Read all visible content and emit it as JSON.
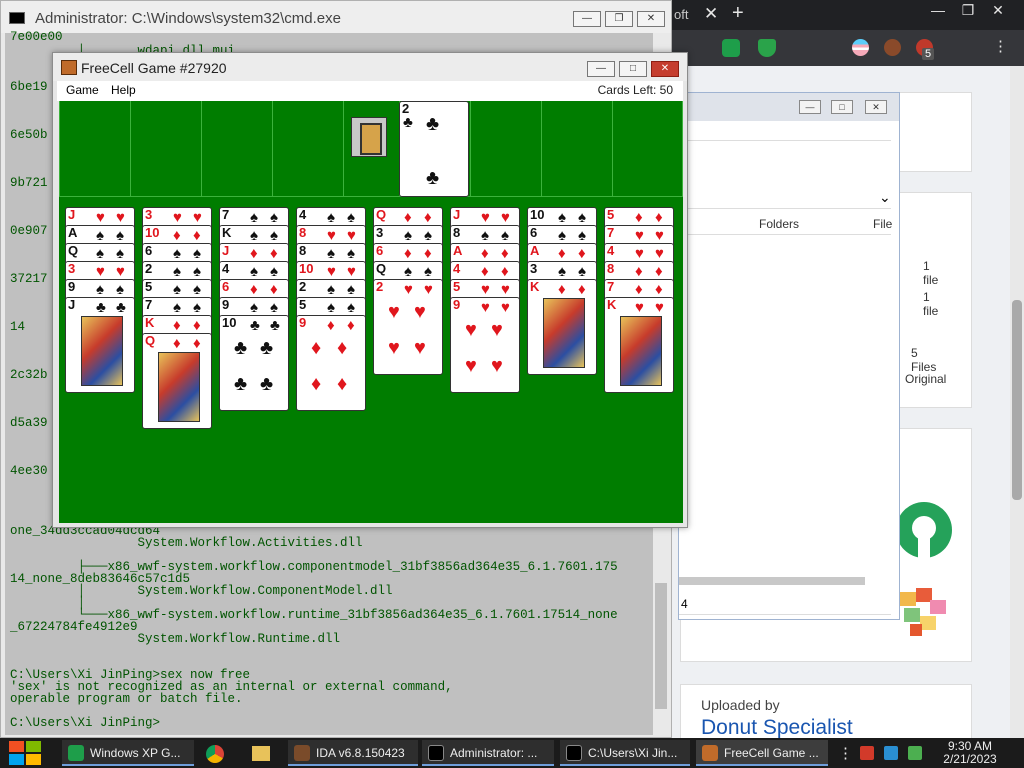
{
  "browser": {
    "tab_tail": "oft",
    "tab_close": "✕",
    "new_tab": "+",
    "window_buttons": [
      "—",
      "❐",
      "✕"
    ],
    "extension_badge": "5",
    "menu": "⋮"
  },
  "explorer": {
    "window_buttons": [
      "—",
      "□",
      "✕"
    ],
    "dropdown_arrow": "⌄",
    "columns": [
      "Folders",
      "File"
    ],
    "rows": [
      "1 file",
      "1 file",
      "5 Files",
      "Original"
    ],
    "path_fragment": "4"
  },
  "web": {
    "uploaded_by_label": "Uploaded by",
    "uploader_name": "Donut Specialist"
  },
  "cmd": {
    "title": "Administrator: C:\\Windows\\system32\\cmd.exe",
    "window_buttons": [
      "—",
      "❐",
      "✕"
    ],
    "lines": [
      "7e00e00",
      "         │       wdapi.dll.mui",
      "6be19",
      "6e50b",
      "9b721",
      "0e907",
      "37217",
      "14",
      "2c32b",
      "d5a39",
      "4ee30",
      "one_34dd3ccad04dcd64",
      "                 System.Workflow.Activities.dll",
      "         ├───x86_wwf-system.workflow.componentmodel_31bf3856ad364e35_6.1.7601.175",
      "14_none_8deb83646c57c1d5",
      "         │       System.Workflow.ComponentModel.dll",
      "         │",
      "         └───x86_wwf-system.workflow.runtime_31bf3856ad364e35_6.1.7601.17514_none",
      "_67224784fe4912e9",
      "                 System.Workflow.Runtime.dll",
      "",
      "C:\\Users\\Xi JinPing>sex now free",
      "'sex' is not recognized as an internal or external command,",
      "operable program or batch file.",
      "",
      "C:\\Users\\Xi JinPing>"
    ]
  },
  "freecell": {
    "title": "FreeCell Game #27920",
    "window_buttons": [
      "—",
      "□",
      "✕"
    ],
    "menu": [
      "Game",
      "Help"
    ],
    "cards_left": "Cards Left: 50",
    "foundation_card": {
      "rank": "2",
      "suit": "♣"
    },
    "columns": [
      {
        "cards": [
          [
            "J",
            "♥"
          ],
          [
            "A",
            "♠"
          ],
          [
            "Q",
            "♠"
          ],
          [
            "3",
            "♥"
          ],
          [
            "9",
            "♠"
          ],
          [
            "J",
            "♣"
          ]
        ]
      },
      {
        "cards": [
          [
            "3",
            "♥"
          ],
          [
            "10",
            "♦"
          ],
          [
            "6",
            "♠"
          ],
          [
            "2",
            "♠"
          ],
          [
            "5",
            "♠"
          ],
          [
            "7",
            "♠"
          ],
          [
            "K",
            "♦"
          ],
          [
            "Q",
            "♦"
          ]
        ]
      },
      {
        "cards": [
          [
            "7",
            "♠"
          ],
          [
            "K",
            "♠"
          ],
          [
            "J",
            "♦"
          ],
          [
            "4",
            "♠"
          ],
          [
            "6",
            "♦"
          ],
          [
            "9",
            "♠"
          ],
          [
            "10",
            "♣"
          ]
        ]
      },
      {
        "cards": [
          [
            "4",
            "♠"
          ],
          [
            "8",
            "♥"
          ],
          [
            "8",
            "♠"
          ],
          [
            "10",
            "♥"
          ],
          [
            "2",
            "♠"
          ],
          [
            "5",
            "♠"
          ],
          [
            "9",
            "♦"
          ]
        ]
      },
      {
        "cards": [
          [
            "Q",
            "♦"
          ],
          [
            "3",
            "♠"
          ],
          [
            "6",
            "♦"
          ],
          [
            "Q",
            "♠"
          ],
          [
            "2",
            "♥"
          ]
        ]
      },
      {
        "cards": [
          [
            "J",
            "♥"
          ],
          [
            "8",
            "♠"
          ],
          [
            "A",
            "♦"
          ],
          [
            "4",
            "♦"
          ],
          [
            "5",
            "♥"
          ],
          [
            "9",
            "♥"
          ]
        ]
      },
      {
        "cards": [
          [
            "10",
            "♠"
          ],
          [
            "6",
            "♠"
          ],
          [
            "A",
            "♦"
          ],
          [
            "3",
            "♠"
          ],
          [
            "K",
            "♦"
          ]
        ]
      },
      {
        "cards": [
          [
            "5",
            "♦"
          ],
          [
            "7",
            "♥"
          ],
          [
            "4",
            "♥"
          ],
          [
            "8",
            "♦"
          ],
          [
            "7",
            "♦"
          ],
          [
            "K",
            "♥"
          ]
        ]
      }
    ]
  },
  "taskbar": {
    "items": [
      "Windows XP G...",
      "IDA v6.8.150423",
      "Administrator: ...",
      "C:\\Users\\Xi Jin...",
      "FreeCell Game ..."
    ],
    "overflow": "⋮",
    "time": "9:30 AM",
    "date": "2/21/2023"
  },
  "colors": {
    "felt": "#007d00",
    "cmd_text": "#005400",
    "card_red": "#e0161d",
    "link_blue": "#1a56b0"
  }
}
